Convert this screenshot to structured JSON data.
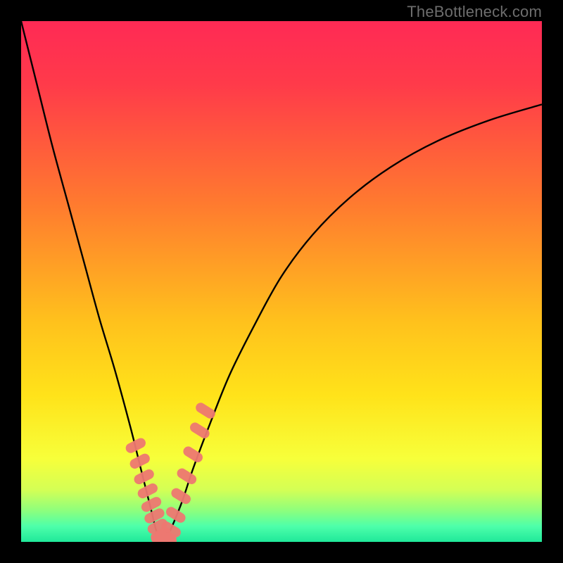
{
  "watermark": "TheBottleneck.com",
  "colors": {
    "gradient_stops": [
      {
        "pct": 0,
        "color": "#ff2a55"
      },
      {
        "pct": 12,
        "color": "#ff3a4a"
      },
      {
        "pct": 35,
        "color": "#ff7a2f"
      },
      {
        "pct": 58,
        "color": "#ffc21c"
      },
      {
        "pct": 72,
        "color": "#ffe31a"
      },
      {
        "pct": 84,
        "color": "#f7ff3a"
      },
      {
        "pct": 90,
        "color": "#d4ff55"
      },
      {
        "pct": 94,
        "color": "#8dff7d"
      },
      {
        "pct": 97,
        "color": "#4dffaa"
      },
      {
        "pct": 100,
        "color": "#20e89a"
      }
    ],
    "curve": "#000000",
    "markers": "#ed7871",
    "frame": "#000000"
  },
  "chart_data": {
    "type": "line",
    "title": "",
    "xlabel": "",
    "ylabel": "",
    "xlim": [
      0,
      100
    ],
    "ylim": [
      0,
      100
    ],
    "note": "Bottleneck-style V curve. x = configuration parameter (0–100), y = bottleneck % (0 = no bottleneck at dip, 100 = full bottleneck). Minimum near x≈27.",
    "series": [
      {
        "name": "bottleneck_curve",
        "x": [
          0,
          3,
          6,
          9,
          12,
          15,
          18,
          21,
          23,
          25,
          26,
          27,
          28,
          29,
          31,
          33,
          36,
          40,
          45,
          50,
          56,
          63,
          71,
          80,
          90,
          100
        ],
        "y": [
          100,
          88,
          76,
          65,
          54,
          43,
          33,
          22,
          14,
          6,
          2,
          0,
          1,
          3,
          8,
          14,
          22,
          32,
          42,
          51,
          59,
          66,
          72,
          77,
          81,
          84
        ]
      }
    ],
    "markers": {
      "name": "highlighted_points",
      "note": "Pink/coral rounded markers near the dip on both arms",
      "x": [
        22.0,
        22.8,
        23.6,
        24.3,
        25.0,
        25.6,
        26.2,
        26.8,
        27.4,
        28.0,
        28.8,
        29.7,
        30.7,
        31.8,
        33.0,
        34.3,
        35.4
      ],
      "y": [
        18.5,
        15.5,
        12.5,
        9.8,
        7.2,
        5.0,
        3.0,
        1.4,
        0.5,
        0.8,
        2.4,
        5.2,
        8.8,
        12.6,
        16.8,
        21.4,
        25.2
      ]
    }
  }
}
